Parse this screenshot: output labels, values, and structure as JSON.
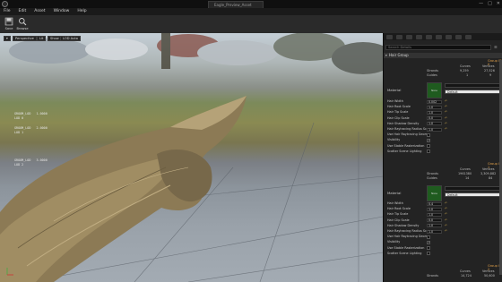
{
  "window": {
    "tab_title": "Eagle_Preview_Asset",
    "buttons": [
      "—",
      "□",
      "✕"
    ]
  },
  "menu": [
    "File",
    "Edit",
    "Asset",
    "Window",
    "Help"
  ],
  "toolbar": {
    "save_label": "Save",
    "browse_label": "Browse"
  },
  "viewport": {
    "view_mode": "Perspective",
    "lighting": "Lit",
    "show": "Show",
    "lod": "LOD Auto",
    "stats": [
      {
        "name": "GROOM_LOD",
        "val": "1.0000"
      },
      {
        "name": "GROOM_LOD",
        "val": "2.0000"
      },
      {
        "name": "GROOM_LOD",
        "val": "3.0000"
      }
    ],
    "stats_sub": [
      "LOD 0",
      "LOD 1",
      "LOD 2"
    ]
  },
  "details": {
    "search_placeholder": "Search Details",
    "hair_group_label": "Hair Group",
    "groups": [
      {
        "group_label": "Group ID 0",
        "curves_label": "Curves",
        "vertices_label": "Vertices",
        "strands_label": "Strands",
        "strands_curves": "9,259",
        "strands_vertices": "27,526",
        "guides_label": "Guides",
        "guides_curves": "1",
        "guides_vertices": "9",
        "material_label": "Material",
        "material_thumb": "None",
        "material_slot": "Default",
        "props": [
          {
            "label": "Hair Width",
            "value": "0.002",
            "type": "num"
          },
          {
            "label": "Hair Root Scale",
            "value": "1.0",
            "type": "num"
          },
          {
            "label": "Hair Tip Scale",
            "value": "1.0",
            "type": "num"
          },
          {
            "label": "Hair Clip Scale",
            "value": "0.0",
            "type": "num"
          },
          {
            "label": "Hair Shadow Density",
            "value": "1.0",
            "type": "num"
          },
          {
            "label": "Hair Raytracing Radius Sc",
            "value": "1.0",
            "type": "num"
          },
          {
            "label": "Use Hair Raytracing Geom",
            "value": "",
            "type": "chk"
          },
          {
            "label": "Visibility",
            "value": "✓",
            "type": "chk"
          },
          {
            "label": "Use Stable Rasterization",
            "value": "",
            "type": "chk"
          },
          {
            "label": "Scatter Scene Lighting",
            "value": "",
            "type": "chk"
          }
        ]
      },
      {
        "group_label": "Group ID 1",
        "curves_label": "Curves",
        "vertices_label": "Vertices",
        "strands_label": "Strands",
        "strands_curves": "1961380",
        "strands_vertices": "3,309,882",
        "guides_label": "Guides",
        "guides_curves": "14",
        "guides_vertices": "84",
        "material_label": "Material",
        "material_thumb": "None",
        "material_slot": "Default",
        "props": [
          {
            "label": "Hair Width",
            "value": "0.4",
            "type": "num"
          },
          {
            "label": "Hair Root Scale",
            "value": "1.0",
            "type": "num"
          },
          {
            "label": "Hair Tip Scale",
            "value": "1.0",
            "type": "num"
          },
          {
            "label": "Hair Clip Scale",
            "value": "0.0",
            "type": "num"
          },
          {
            "label": "Hair Shadow Density",
            "value": "1.0",
            "type": "num"
          },
          {
            "label": "Hair Raytracing Radius Sc",
            "value": "1.0",
            "type": "num"
          },
          {
            "label": "Use Hair Raytracing Geom",
            "value": "",
            "type": "chk"
          },
          {
            "label": "Visibility",
            "value": "✓",
            "type": "chk"
          },
          {
            "label": "Use Stable Rasterization",
            "value": "",
            "type": "chk"
          },
          {
            "label": "Scatter Scene Lighting",
            "value": "",
            "type": "chk"
          }
        ]
      },
      {
        "group_label": "Group ID 2",
        "curves_label": "Curves",
        "vertices_label": "Vertices",
        "strands_label": "Strands",
        "strands_curves": "14,724",
        "strands_vertices": "50,600"
      }
    ]
  },
  "colors": {
    "accent": "#e0a04a",
    "panel_bg": "#232323",
    "toolbar_bg": "#2a2a2a",
    "material_green": "#1f5b1f"
  }
}
